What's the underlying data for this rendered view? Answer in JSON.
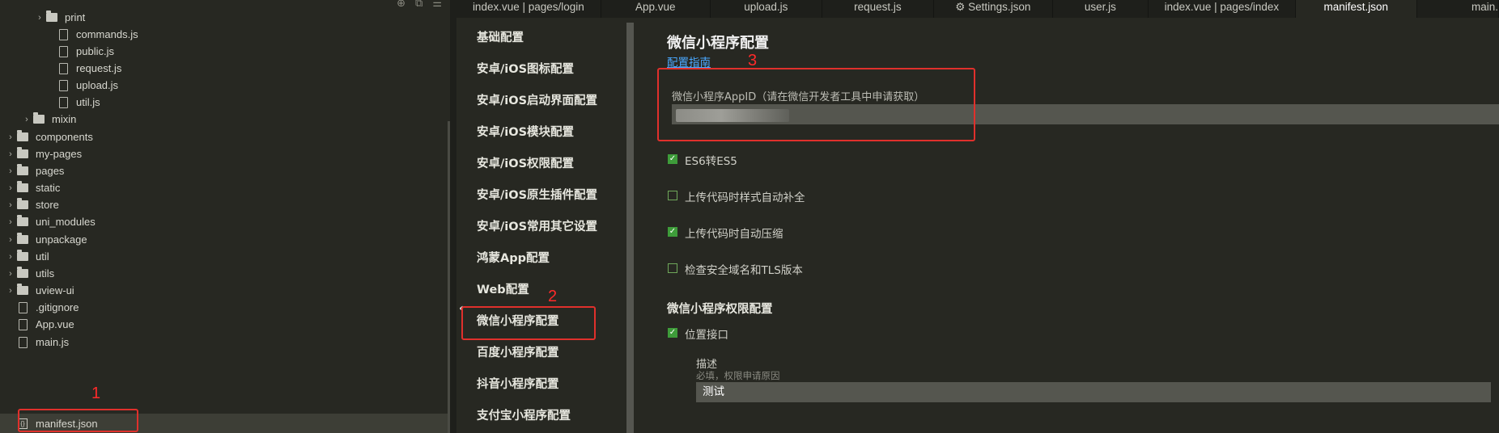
{
  "file_tree": {
    "items": [
      {
        "label": "print",
        "kind": "folder",
        "expandable": true
      },
      {
        "label": "commands.js",
        "kind": "file"
      },
      {
        "label": "public.js",
        "kind": "file"
      },
      {
        "label": "request.js",
        "kind": "file"
      },
      {
        "label": "upload.js",
        "kind": "file"
      },
      {
        "label": "util.js",
        "kind": "file"
      },
      {
        "label": "mixin",
        "kind": "folder",
        "expandable": true
      },
      {
        "label": "components",
        "kind": "folder",
        "expandable": true
      },
      {
        "label": "my-pages",
        "kind": "folder",
        "expandable": true
      },
      {
        "label": "pages",
        "kind": "folder",
        "expandable": true
      },
      {
        "label": "static",
        "kind": "folder",
        "expandable": true
      },
      {
        "label": "store",
        "kind": "folder",
        "expandable": true
      },
      {
        "label": "uni_modules",
        "kind": "folder",
        "expandable": true
      },
      {
        "label": "unpackage",
        "kind": "folder",
        "expandable": true
      },
      {
        "label": "util",
        "kind": "folder",
        "expandable": true
      },
      {
        "label": "utils",
        "kind": "folder",
        "expandable": true
      },
      {
        "label": "uview-ui",
        "kind": "folder",
        "expandable": true
      },
      {
        "label": ".gitignore",
        "kind": "file"
      },
      {
        "label": "App.vue",
        "kind": "file"
      },
      {
        "label": "main.js",
        "kind": "file"
      },
      {
        "label": "manifest.json",
        "kind": "json",
        "selected": true
      }
    ]
  },
  "tabs": [
    {
      "label": "index.vue | pages/login"
    },
    {
      "label": "App.vue"
    },
    {
      "label": "upload.js"
    },
    {
      "label": "request.js"
    },
    {
      "label": "Settings.json",
      "icon": "gear-icon"
    },
    {
      "label": "user.js"
    },
    {
      "label": "index.vue | pages/index"
    },
    {
      "label": "manifest.json",
      "active": true
    },
    {
      "label": "main."
    }
  ],
  "config_nav": {
    "items": [
      {
        "label": "基础配置"
      },
      {
        "label": "安卓/iOS图标配置"
      },
      {
        "label": "安卓/iOS启动界面配置"
      },
      {
        "label": "安卓/iOS模块配置"
      },
      {
        "label": "安卓/iOS权限配置"
      },
      {
        "label": "安卓/iOS原生插件配置"
      },
      {
        "label": "安卓/iOS常用其它设置"
      },
      {
        "label": "鸿蒙App配置"
      },
      {
        "label": "Web配置"
      },
      {
        "label": "微信小程序配置",
        "active": true
      },
      {
        "label": "百度小程序配置"
      },
      {
        "label": "抖音小程序配置"
      },
      {
        "label": "支付宝小程序配置"
      }
    ]
  },
  "form": {
    "title": "微信小程序配置",
    "guide_link": "配置指南",
    "appid_label": "微信小程序AppID（请在微信开发者工具中申请获取）",
    "appid_value": "",
    "checkboxes": [
      {
        "label": "ES6转ES5",
        "checked": true
      },
      {
        "label": "上传代码时样式自动补全",
        "checked": false
      },
      {
        "label": "上传代码时自动压缩",
        "checked": true
      },
      {
        "label": "检查安全域名和TLS版本",
        "checked": false
      }
    ],
    "permission_section": "微信小程序权限配置",
    "location_checkbox": {
      "label": "位置接口",
      "checked": true
    },
    "desc_label": "描述",
    "desc_hint": "必填，权限申请原因",
    "desc_value": "测试"
  },
  "annotations": {
    "numbers": [
      "1",
      "2",
      "3"
    ],
    "color": "#e0302c"
  },
  "colors": {
    "background": "#272822",
    "link": "#4aa8ff",
    "checkbox_on": "#3e9c3a"
  }
}
